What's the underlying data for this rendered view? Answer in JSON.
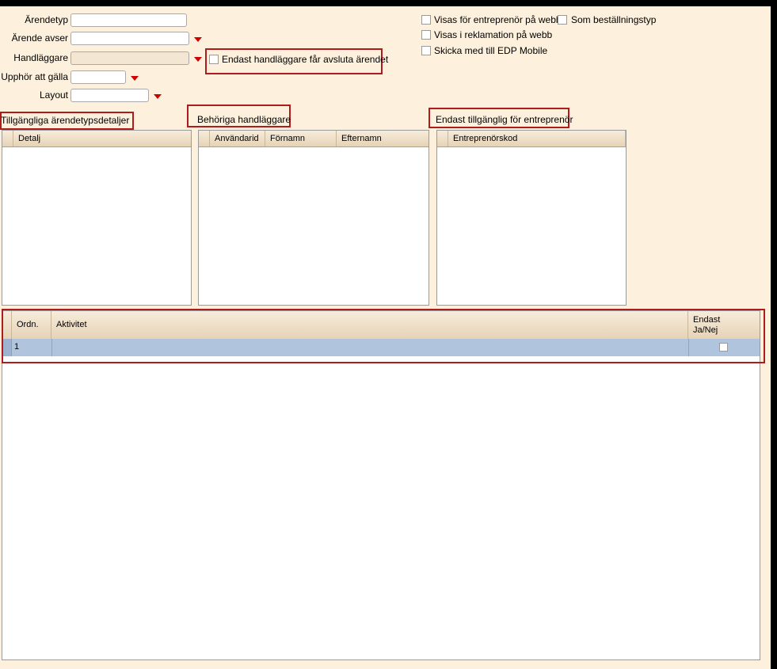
{
  "form": {
    "arendetyp_label": "Ärendetyp",
    "arende_avser_label": "Ärende avser",
    "handlaggare_label": "Handläggare",
    "upphor_label": "Upphör att gälla",
    "layout_label": "Layout",
    "endast_handlaggare_label": "Endast handläggare får avsluta ärendet"
  },
  "options": {
    "visas_entreprenor": "Visas för entreprenör på webb",
    "som_bestallningstyp": "Som beställningstyp",
    "visas_reklamation": "Visas i reklamation på webb",
    "skicka_edp": "Skicka med till EDP Mobile"
  },
  "sections": {
    "details_title": "Tillgängliga ärendetypsdetaljer",
    "handlaggare_title": "Behöriga handläggare",
    "entreprenor_title": "Endast tillgänglig för entreprenör"
  },
  "grids": {
    "details": {
      "columns": [
        "Detalj"
      ]
    },
    "handlaggare": {
      "columns": [
        "Användarid",
        "Förnamn",
        "Efternamn"
      ]
    },
    "entreprenor": {
      "columns": [
        "Entreprenörskod"
      ]
    },
    "activities": {
      "columns": [
        "Ordn.",
        "Aktivitet",
        "Endast Ja/Nej"
      ],
      "rows": [
        {
          "ordn": "1",
          "aktivitet": "",
          "endast": false
        }
      ]
    }
  },
  "colors": {
    "panel": "#fdf0dc",
    "highlight": "#b01c1c",
    "row_selected": "#b0c4de",
    "dropdown_arrow": "#d00000"
  },
  "icons": {
    "dropdown": "chevron-down-icon"
  }
}
